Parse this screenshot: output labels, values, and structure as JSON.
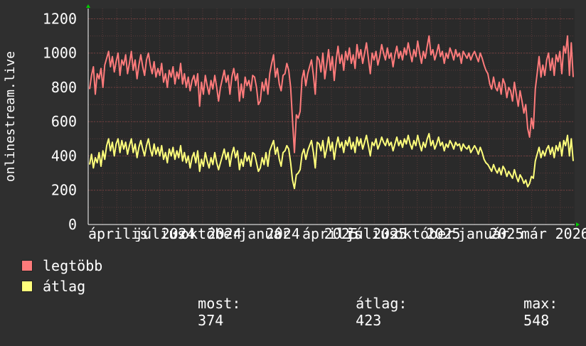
{
  "colors": {
    "background": "#2f2f2f",
    "plot_background": "#2a2a2a",
    "grid": "#5a3a3a",
    "series_max": "#ff7b7b",
    "series_avg": "#ffff7b",
    "axis_arrow": "#00cc00"
  },
  "chart_data": {
    "type": "line",
    "ylabel": "onlinestream.live",
    "ylim": [
      0,
      1260
    ],
    "yticks": [
      0,
      200,
      400,
      600,
      800,
      1000,
      1200
    ],
    "xlim": [
      0,
      100
    ],
    "xticks": [
      {
        "pos": 0,
        "label": "április"
      },
      {
        "pos": 9.5,
        "label": "július"
      },
      {
        "pos": 15,
        "label": "2024"
      },
      {
        "pos": 19,
        "label": "október"
      },
      {
        "pos": 24.5,
        "label": "2024"
      },
      {
        "pos": 31,
        "label": "január"
      },
      {
        "pos": 36.5,
        "label": "2024"
      },
      {
        "pos": 44,
        "label": "április"
      },
      {
        "pos": 48.5,
        "label": "2025"
      },
      {
        "pos": 53,
        "label": "július"
      },
      {
        "pos": 58.5,
        "label": "2025"
      },
      {
        "pos": 63,
        "label": "október"
      },
      {
        "pos": 69.5,
        "label": "2025"
      },
      {
        "pos": 76,
        "label": "január"
      },
      {
        "pos": 82.5,
        "label": "2025"
      },
      {
        "pos": 89,
        "label": "már"
      },
      {
        "pos": 96,
        "label": "2026"
      }
    ],
    "series": [
      {
        "name": "legtöbb",
        "values": [
          790,
          870,
          920,
          760,
          880,
          850,
          910,
          800,
          930,
          970,
          1010,
          920,
          980,
          890,
          950,
          1000,
          870,
          960,
          930,
          990,
          880,
          940,
          1010,
          900,
          960,
          850,
          930,
          990,
          920,
          870,
          960,
          1000,
          930,
          880,
          950,
          860,
          910,
          870,
          940,
          830,
          880,
          800,
          900,
          860,
          920,
          820,
          890,
          850,
          940,
          820,
          880,
          800,
          860,
          780,
          840,
          870,
          810,
          880,
          690,
          830,
          760,
          870,
          810,
          760,
          840,
          790,
          870,
          800,
          720,
          800,
          850,
          900,
          830,
          870,
          760,
          860,
          910,
          840,
          880,
          720,
          820,
          740,
          860,
          810,
          840,
          780,
          870,
          860,
          800,
          700,
          720,
          830,
          780,
          850,
          760,
          880,
          940,
          990,
          860,
          910,
          820,
          780,
          870,
          880,
          940,
          900,
          800,
          610,
          420,
          640,
          620,
          660,
          850,
          900,
          810,
          880,
          920,
          960,
          870,
          760,
          980,
          960,
          890,
          1000,
          850,
          930,
          1020,
          900,
          980,
          840,
          960,
          1040,
          940,
          990,
          900,
          1010,
          960,
          1030,
          940,
          990,
          910,
          1050,
          970,
          1020,
          940,
          1000,
          1060,
          970,
          880,
          1000,
          960,
          1010,
          930,
          980,
          1050,
          1000,
          960,
          1030,
          970,
          1000,
          920,
          990,
          1040,
          970,
          1010,
          960,
          1030,
          990,
          1060,
          1000,
          950,
          1020,
          980,
          1070,
          1000,
          940,
          1010,
          970,
          1040,
          1100,
          990,
          1020,
          960,
          1000,
          1050,
          980,
          1010,
          940,
          1000,
          970,
          1030,
          1000,
          960,
          1020,
          980,
          1000,
          940,
          1010,
          990,
          970,
          1000,
          960,
          990,
          1010,
          980,
          950,
          1000,
          970,
          930,
          900,
          880,
          820,
          790,
          860,
          800,
          780,
          830,
          760,
          850,
          820,
          740,
          800,
          780,
          720,
          830,
          760,
          690,
          780,
          720,
          650,
          700,
          560,
          510,
          620,
          560,
          790,
          880,
          980,
          860,
          930,
          870,
          960,
          1000,
          900,
          970,
          870,
          990,
          950,
          1010,
          880,
          1040,
          1000,
          1100,
          870,
          1060,
          860
        ],
        "color": "#ff7b7b"
      },
      {
        "name": "átlag",
        "values": [
          350,
          410,
          330,
          390,
          360,
          420,
          340,
          430,
          380,
          460,
          500,
          430,
          480,
          400,
          470,
          500,
          420,
          490,
          440,
          480,
          410,
          460,
          500,
          420,
          470,
          390,
          450,
          490,
          440,
          400,
          460,
          500,
          440,
          400,
          470,
          410,
          450,
          400,
          460,
          380,
          420,
          360,
          440,
          400,
          450,
          380,
          430,
          390,
          460,
          370,
          420,
          360,
          400,
          330,
          390,
          420,
          360,
          430,
          310,
          380,
          340,
          420,
          370,
          330,
          390,
          350,
          420,
          360,
          320,
          360,
          400,
          440,
          380,
          420,
          340,
          410,
          450,
          390,
          430,
          320,
          380,
          340,
          420,
          370,
          400,
          340,
          420,
          410,
          360,
          310,
          330,
          390,
          350,
          420,
          340,
          430,
          460,
          490,
          410,
          450,
          380,
          340,
          420,
          430,
          460,
          440,
          360,
          260,
          210,
          290,
          300,
          320,
          410,
          440,
          380,
          430,
          460,
          490,
          420,
          330,
          480,
          470,
          430,
          490,
          390,
          440,
          510,
          430,
          480,
          380,
          460,
          510,
          450,
          480,
          420,
          490,
          460,
          510,
          440,
          480,
          420,
          510,
          460,
          500,
          440,
          480,
          520,
          460,
          400,
          480,
          460,
          500,
          440,
          470,
          510,
          480,
          460,
          500,
          460,
          480,
          430,
          470,
          510,
          460,
          490,
          450,
          500,
          470,
          520,
          470,
          440,
          490,
          460,
          520,
          470,
          430,
          480,
          450,
          500,
          530,
          460,
          490,
          440,
          470,
          510,
          460,
          480,
          430,
          470,
          450,
          490,
          470,
          440,
          480,
          460,
          470,
          430,
          470,
          450,
          440,
          460,
          420,
          440,
          460,
          440,
          410,
          450,
          420,
          380,
          360,
          350,
          330,
          310,
          350,
          320,
          300,
          330,
          290,
          340,
          320,
          280,
          310,
          290,
          270,
          320,
          280,
          250,
          290,
          270,
          240,
          260,
          220,
          240,
          280,
          270,
          370,
          410,
          450,
          390,
          430,
          400,
          440,
          460,
          410,
          450,
          390,
          460,
          430,
          480,
          400,
          490,
          460,
          520,
          400,
          500,
          370
        ],
        "color": "#ffff7b"
      }
    ],
    "legend": [
      {
        "name": "legtöbb",
        "color": "#ff7b7b"
      },
      {
        "name": "átlag",
        "color": "#ffff7b"
      }
    ],
    "stats": {
      "most_label": "most:",
      "most_value": "374",
      "atlag_label": "átlag:",
      "atlag_value": "423",
      "max_label": "max:",
      "max_value": "548"
    }
  }
}
